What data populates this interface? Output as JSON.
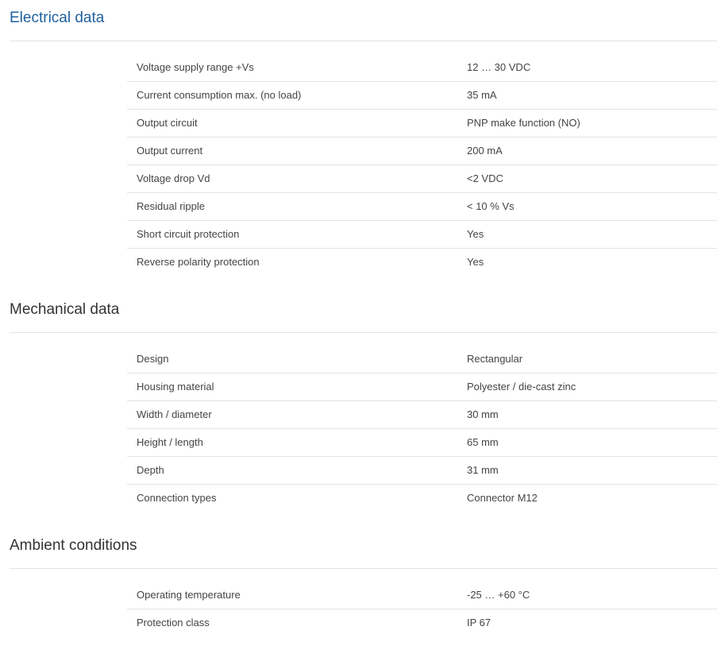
{
  "sections": [
    {
      "title": "Electrical data",
      "title_color": "#1f5f9e",
      "rows": [
        {
          "label": "Voltage supply range +Vs",
          "value": "12 … 30 VDC"
        },
        {
          "label": "Current consumption max. (no load)",
          "value": "35 mA"
        },
        {
          "label": "Output circuit",
          "value": "PNP make function (NO)"
        },
        {
          "label": "Output current",
          "value": "200 mA"
        },
        {
          "label": "Voltage drop Vd",
          "value": "<2 VDC"
        },
        {
          "label": "Residual ripple",
          "value": "< 10 % Vs"
        },
        {
          "label": "Short circuit protection",
          "value": "Yes"
        },
        {
          "label": "Reverse polarity protection",
          "value": "Yes"
        }
      ]
    },
    {
      "title": "Mechanical data",
      "title_color": "#333333",
      "rows": [
        {
          "label": "Design",
          "value": "Rectangular"
        },
        {
          "label": "Housing material",
          "value": "Polyester / die-cast zinc"
        },
        {
          "label": "Width / diameter",
          "value": "30 mm"
        },
        {
          "label": "Height / length",
          "value": "65 mm"
        },
        {
          "label": "Depth",
          "value": "31 mm"
        },
        {
          "label": "Connection types",
          "value": "Connector M12"
        }
      ]
    },
    {
      "title": "Ambient conditions",
      "title_color": "#333333",
      "rows": [
        {
          "label": "Operating temperature",
          "value": "-25 … +60 °C"
        },
        {
          "label": "Protection class",
          "value": "IP 67"
        }
      ]
    }
  ]
}
